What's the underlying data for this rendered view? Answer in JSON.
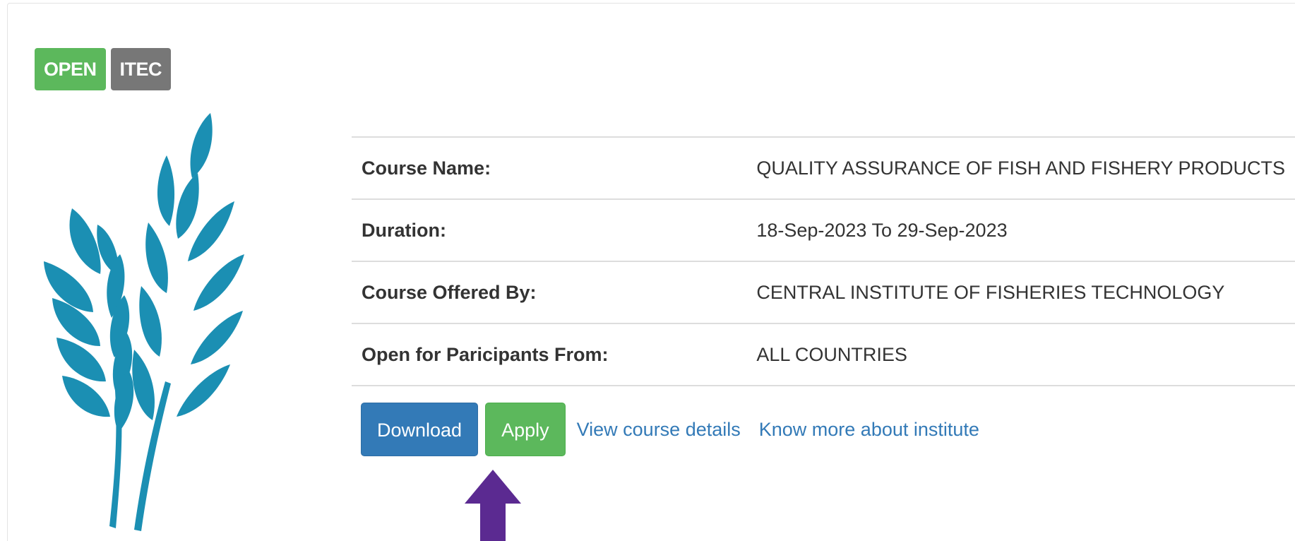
{
  "labels": {
    "open": "OPEN",
    "itec": "ITEC"
  },
  "logo": {
    "icon": "wheat-icon",
    "color": "#1b8fb3"
  },
  "course": {
    "rows": [
      {
        "key": "Course Name:",
        "value": "QUALITY ASSURANCE OF FISH AND FISHERY PRODUCTS"
      },
      {
        "key": "Duration:",
        "value": "18-Sep-2023 To 29-Sep-2023"
      },
      {
        "key": "Course Offered By:",
        "value": "CENTRAL INSTITUTE OF FISHERIES TECHNOLOGY"
      },
      {
        "key": "Open for Paricipants From:",
        "value": "ALL COUNTRIES"
      }
    ]
  },
  "actions": {
    "download_label": "Download",
    "apply_label": "Apply",
    "view_details_label": "View course details",
    "know_more_label": "Know more about institute"
  },
  "annotation": {
    "icon": "arrow-up-icon",
    "color": "#5b2a91"
  },
  "colors": {
    "success": "#5cb85c",
    "primary": "#337ab7",
    "default_label": "#777777",
    "link": "#337ab7"
  }
}
